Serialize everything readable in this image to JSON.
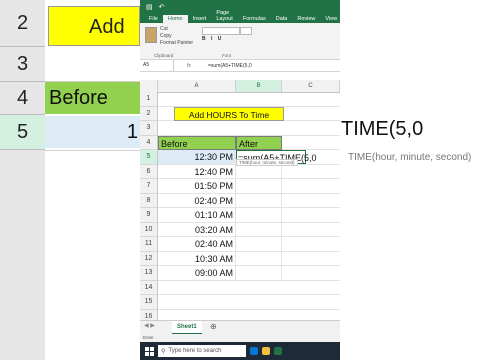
{
  "background": {
    "row_headers": [
      "2",
      "3",
      "4",
      "5"
    ],
    "add_text": "Add",
    "before_text": "Before",
    "selected_value": "1",
    "right_text": "TIME(5,0",
    "right_tip": "TIME(hour, minute, second)"
  },
  "excel": {
    "window_title": "",
    "tabs": [
      "File",
      "Home",
      "Insert",
      "Page Layout",
      "Formulas",
      "Data",
      "Review",
      "View"
    ],
    "active_tab": "Home",
    "clipboard": {
      "cut": "Cut",
      "copy": "Copy",
      "format_painter": "Format Painter",
      "group": "Clipboard"
    },
    "font_group": "Font",
    "name_box": "A5",
    "formula": "=sum(A5+TIME(5,0",
    "columns": [
      "A",
      "B",
      "C"
    ],
    "row_numbers": [
      "1",
      "2",
      "3",
      "4",
      "5",
      "6",
      "7",
      "8",
      "9",
      "10",
      "11",
      "12",
      "13",
      "14",
      "15",
      "16",
      "17",
      "18"
    ],
    "title_cell": "Add HOURS To Time",
    "header_before": "Before",
    "header_after": "After",
    "times": [
      "12:30 PM",
      "12:40 PM",
      "01:50 PM",
      "02:40 PM",
      "01:10 AM",
      "03:20 AM",
      "02:40 AM",
      "10:30 AM",
      "09:00 AM"
    ],
    "b5_text": "=sum(A5+TIME(5,0",
    "tooltip": "TIME(hour, minute, second)",
    "sheet_tab": "Sheet1",
    "status": "Enter",
    "taskbar_search": "Type here to search",
    "colors": {
      "excel_green": "#217346",
      "title_yellow": "#ffff00",
      "header_green": "#92d050",
      "selected_blue": "#ddebf7"
    }
  }
}
